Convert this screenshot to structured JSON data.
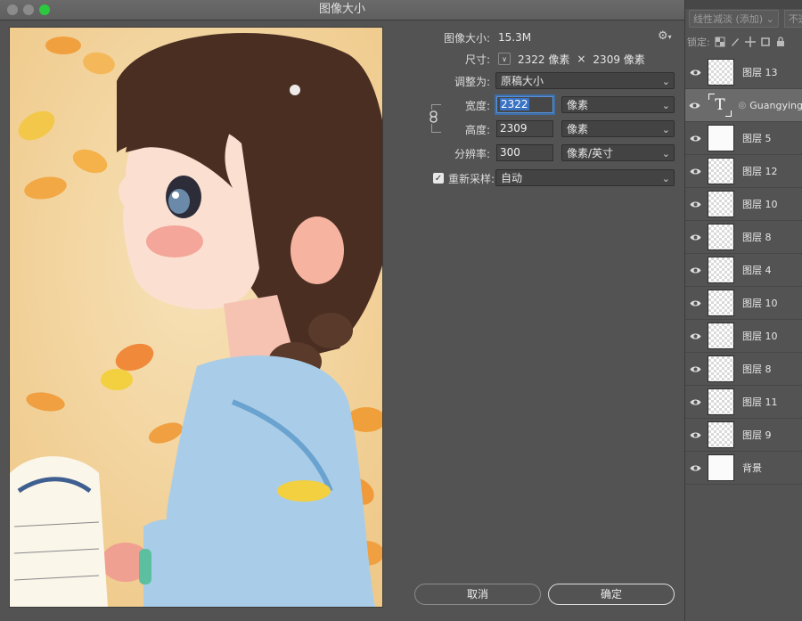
{
  "dialog": {
    "title": "图像大小",
    "image_size_label": "图像大小:",
    "image_size_value": "15.3M",
    "dimensions_label": "尺寸:",
    "dimensions_width": "2322 像素",
    "dimensions_times": "×",
    "dimensions_height": "2309 像素",
    "fit_label": "调整为:",
    "fit_value": "原稿大小",
    "width_label": "宽度:",
    "width_value": "2322",
    "width_unit": "像素",
    "height_label": "高度:",
    "height_value": "2309",
    "height_unit": "像素",
    "resolution_label": "分辨率:",
    "resolution_value": "300",
    "resolution_unit": "像素/英寸",
    "resample_label": "重新采样:",
    "resample_checked": true,
    "resample_value": "自动",
    "cancel_label": "取消",
    "ok_label": "确定",
    "gear_icon": "gear-icon",
    "chevron_icon": "chevron-down-icon"
  },
  "layers_panel": {
    "blend_mode": "线性减淡 (添加)",
    "opacity_label": "不透明",
    "lock_label": "锁定:",
    "selected_index": 1,
    "layers": [
      {
        "name": "图层 13",
        "thumb": "transparent"
      },
      {
        "name": "Guangying",
        "thumb": "text"
      },
      {
        "name": "图层 5",
        "thumb": "white"
      },
      {
        "name": "图层 12",
        "thumb": "transparent"
      },
      {
        "name": "图层 10",
        "thumb": "transparent"
      },
      {
        "name": "图层 8",
        "thumb": "transparent"
      },
      {
        "name": "图层 4",
        "thumb": "transparent"
      },
      {
        "name": "图层 10",
        "thumb": "transparent"
      },
      {
        "name": "图层 10",
        "thumb": "transparent"
      },
      {
        "name": "图层 8",
        "thumb": "transparent"
      },
      {
        "name": "图层 11",
        "thumb": "transparent"
      },
      {
        "name": "图层 9",
        "thumb": "transparent"
      },
      {
        "name": "背景",
        "thumb": "white"
      }
    ]
  },
  "colors": {
    "panel_bg": "#535353",
    "accent_focus": "#3b73c4",
    "zoom_button": "#2bc840"
  }
}
